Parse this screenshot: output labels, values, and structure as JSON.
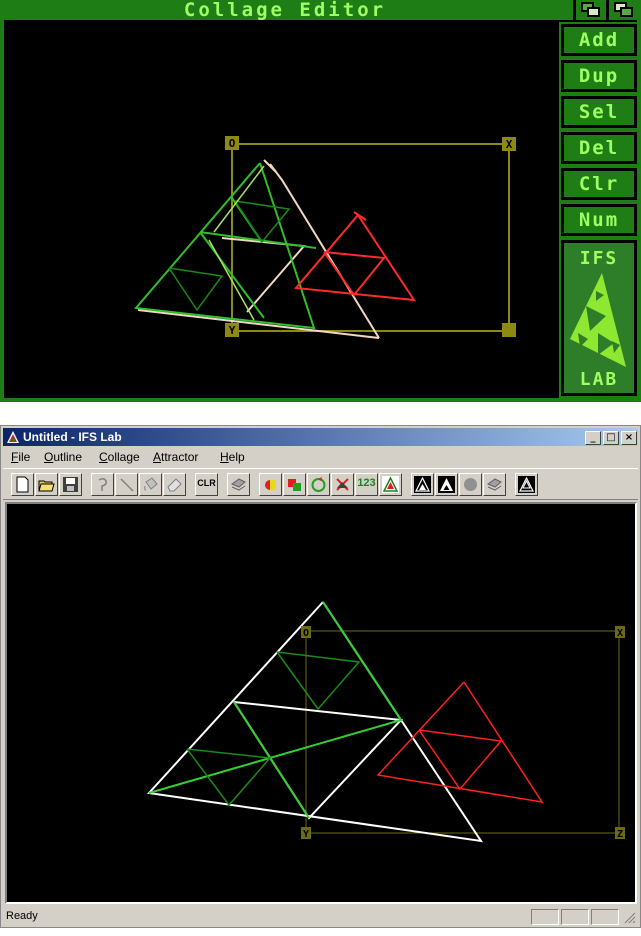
{
  "amiga": {
    "title": "Collage Editor",
    "buttons": [
      "Add",
      "Dup",
      "Sel",
      "Del",
      "Clr",
      "Num"
    ],
    "logo_top": "IFS",
    "logo_bottom": "LAB",
    "colors": {
      "accent": "#1e7d14",
      "text": "#9eff62",
      "selection": "#8c8a14",
      "red_triangle": "#ff3030"
    }
  },
  "window": {
    "title": "Untitled - IFS Lab",
    "caption_buttons": [
      "_",
      "□",
      "×"
    ],
    "menu": [
      {
        "label": "File",
        "key": "F"
      },
      {
        "label": "Outline",
        "key": "O"
      },
      {
        "label": "Collage",
        "key": "C"
      },
      {
        "label": "Attractor",
        "key": "A"
      },
      {
        "label": "Help",
        "key": "H"
      }
    ],
    "toolbar": {
      "clr_label": "CLR",
      "num_label": "123",
      "icons": [
        "new-icon",
        "open-icon",
        "save-icon",
        "lasso-icon",
        "line-icon",
        "fill-icon",
        "eraser-icon",
        "clr-icon",
        "rotate-icon",
        "red-green-icon",
        "red-green-square-icon",
        "rotate-circle-icon",
        "delete-icon",
        "numbers-icon",
        "triangle-icon",
        "attractor-1-icon",
        "attractor-2-icon",
        "gray-circle-icon",
        "gray-rotate-icon",
        "attractor-3-icon"
      ]
    },
    "status": "Ready"
  }
}
